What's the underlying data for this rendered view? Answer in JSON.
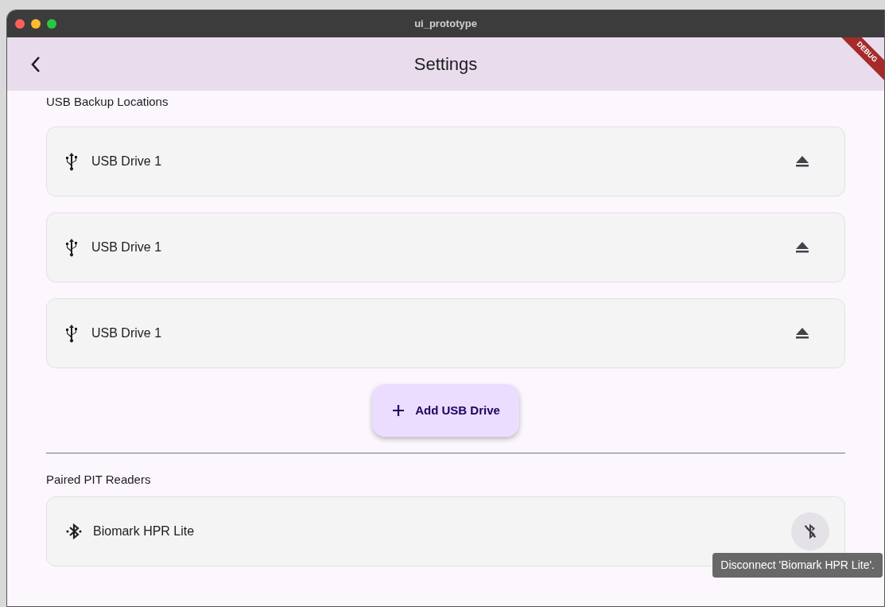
{
  "window": {
    "title": "ui_prototype"
  },
  "app_bar": {
    "title": "Settings",
    "banner": "DEBUG"
  },
  "usb_section": {
    "heading": "USB Backup Locations",
    "drives": [
      {
        "name": "USB Drive 1"
      },
      {
        "name": "USB Drive 1"
      },
      {
        "name": "USB Drive 1"
      }
    ],
    "add_button": "Add USB Drive"
  },
  "readers_section": {
    "heading": "Paired PIT Readers",
    "readers": [
      {
        "name": "Biomark HPR Lite",
        "tooltip": "Disconnect 'Biomark HPR Lite'."
      }
    ]
  }
}
